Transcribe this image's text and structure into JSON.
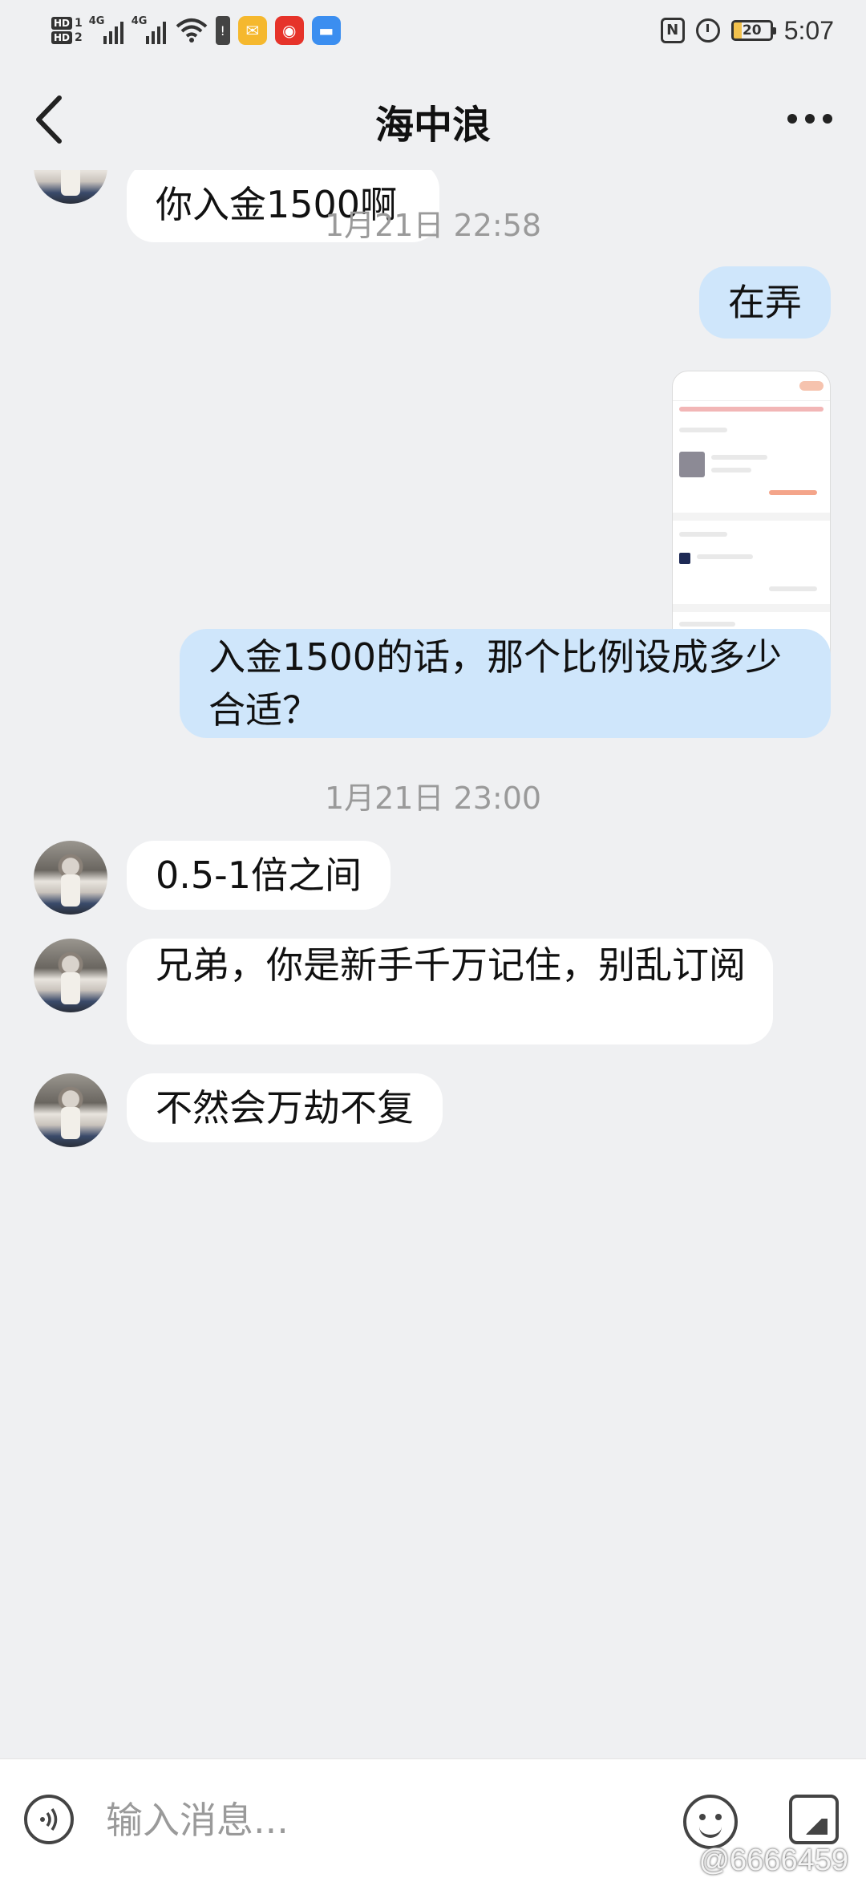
{
  "status_bar": {
    "hd1": "HD",
    "hd1_num": "1",
    "hd2": "HD",
    "hd2_num": "2",
    "net1": "4G",
    "net2": "4G",
    "nfc": "N",
    "battery": "20",
    "time": "5:07"
  },
  "header": {
    "title": "海中浪"
  },
  "messages": [
    {
      "kind": "text",
      "side": "in",
      "text": "你入金1500啊"
    },
    {
      "kind": "timestamp",
      "text": "1月21日 22:58"
    },
    {
      "kind": "text",
      "side": "out",
      "text": "在弄"
    },
    {
      "kind": "image",
      "side": "out"
    },
    {
      "kind": "text",
      "side": "out",
      "text": "入金1500的话，那个比例设成多少合适？"
    },
    {
      "kind": "timestamp",
      "text": "1月21日 23:00"
    },
    {
      "kind": "text",
      "side": "in",
      "text": "0.5-1倍之间"
    },
    {
      "kind": "text",
      "side": "in",
      "text": "兄弟，你是新手千万记住，别乱订阅"
    },
    {
      "kind": "text",
      "side": "in",
      "text": "不然会万劫不复"
    }
  ],
  "input": {
    "placeholder": "输入消息..."
  },
  "watermark": "@6666459"
}
